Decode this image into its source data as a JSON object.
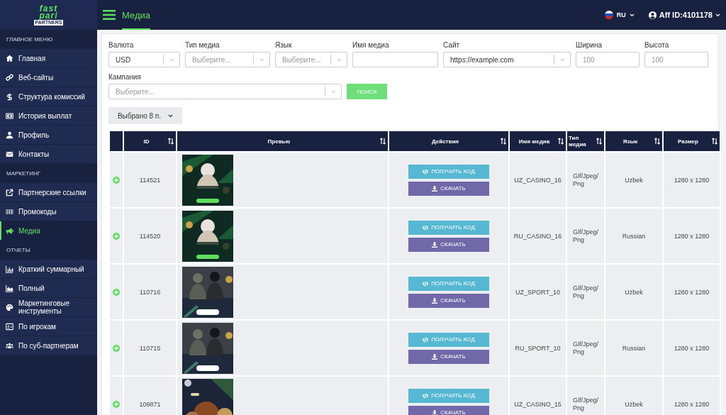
{
  "logo": {
    "line1": "fast",
    "line2": "pari",
    "badge": "PARTNERS"
  },
  "sidebar": {
    "sections": [
      {
        "title": "ГЛАВНОЕ МЕНЮ",
        "items": [
          {
            "label": "Главная",
            "selected": false
          },
          {
            "label": "Веб-сайты",
            "selected": false
          },
          {
            "label": "Структура комиссий",
            "selected": false
          },
          {
            "label": "История выплат",
            "selected": false
          },
          {
            "label": "Профиль",
            "selected": false
          },
          {
            "label": "Контакты",
            "selected": false
          }
        ]
      },
      {
        "title": "МАРКЕТИНГ",
        "items": [
          {
            "label": "Партнерские ссылки",
            "selected": false
          },
          {
            "label": "Промокоды",
            "selected": false
          },
          {
            "label": "Медиа",
            "selected": true
          }
        ]
      },
      {
        "title": "ОТЧЕТЫ",
        "items": [
          {
            "label": "Краткий суммарный",
            "selected": false
          },
          {
            "label": "Полный",
            "selected": false
          },
          {
            "label": "Маркетинговые инструменты",
            "selected": false
          },
          {
            "label": "По игрокам",
            "selected": false
          },
          {
            "label": "По суб-партнерам",
            "selected": false
          }
        ]
      }
    ]
  },
  "topbar": {
    "title": "Медиа",
    "language": "RU",
    "account": "Aff ID:4101178"
  },
  "filters": [
    {
      "label": "Валюта",
      "kind": "select",
      "value": "USD"
    },
    {
      "label": "Тип медиа",
      "kind": "select",
      "placeholder": "Выберите..."
    },
    {
      "label": "Язык",
      "kind": "select",
      "placeholder": "Выберите..."
    },
    {
      "label": "Имя медиа",
      "kind": "input"
    },
    {
      "label": "Сайт",
      "kind": "select",
      "value": "https://example.com"
    },
    {
      "label": "Ширина",
      "kind": "input",
      "placeholder": "100"
    },
    {
      "label": "Высота",
      "kind": "input",
      "placeholder": "100"
    }
  ],
  "campaign": {
    "label": "Кампания",
    "placeholder": "Выберите..."
  },
  "search_button": "ПОИСК",
  "selection_button": "Выбрано 8 п.",
  "table": {
    "columns": [
      "ID",
      "Превью",
      "Действия",
      "Имя медиа",
      "Тип медиа",
      "Язык",
      "Размер"
    ],
    "rows": [
      {
        "id": "114521",
        "actions": [
          "ПОЛУЧИТЬ КОД",
          "СКАЧАТЬ"
        ],
        "name": "UZ_CASINO_16",
        "type": "Gif/Jpeg/ Png",
        "language": "Uzbek",
        "size": "1280 x 1280"
      },
      {
        "id": "114520",
        "actions": [
          "ПОЛУЧИТЬ КОД",
          "СКАЧАТЬ"
        ],
        "name": "RU_CASINO_16",
        "type": "Gif/Jpeg/ Png",
        "language": "Russian",
        "size": "1280 x 1280"
      },
      {
        "id": "110716",
        "actions": [
          "ПОЛУЧИТЬ КОД",
          "СКАЧАТЬ"
        ],
        "name": "UZ_SPORT_10",
        "type": "Gif/Jpeg/ Png",
        "language": "Uzbek",
        "size": "1280 x 1280"
      },
      {
        "id": "110715",
        "actions": [
          "ПОЛУЧИТЬ КОД",
          "СКАЧАТЬ"
        ],
        "name": "RU_SPORT_10",
        "type": "Gif/Jpeg/ Png",
        "language": "Russian",
        "size": "1280 x 1280"
      },
      {
        "id": "109871",
        "actions": [
          "ПОЛУЧИТЬ КОД",
          "СКАЧАТЬ"
        ],
        "name": "UZ_CASINO_15",
        "type": "Gif/Jpeg/ Png",
        "language": "Uzbek",
        "size": "1280 x 1280"
      }
    ]
  }
}
